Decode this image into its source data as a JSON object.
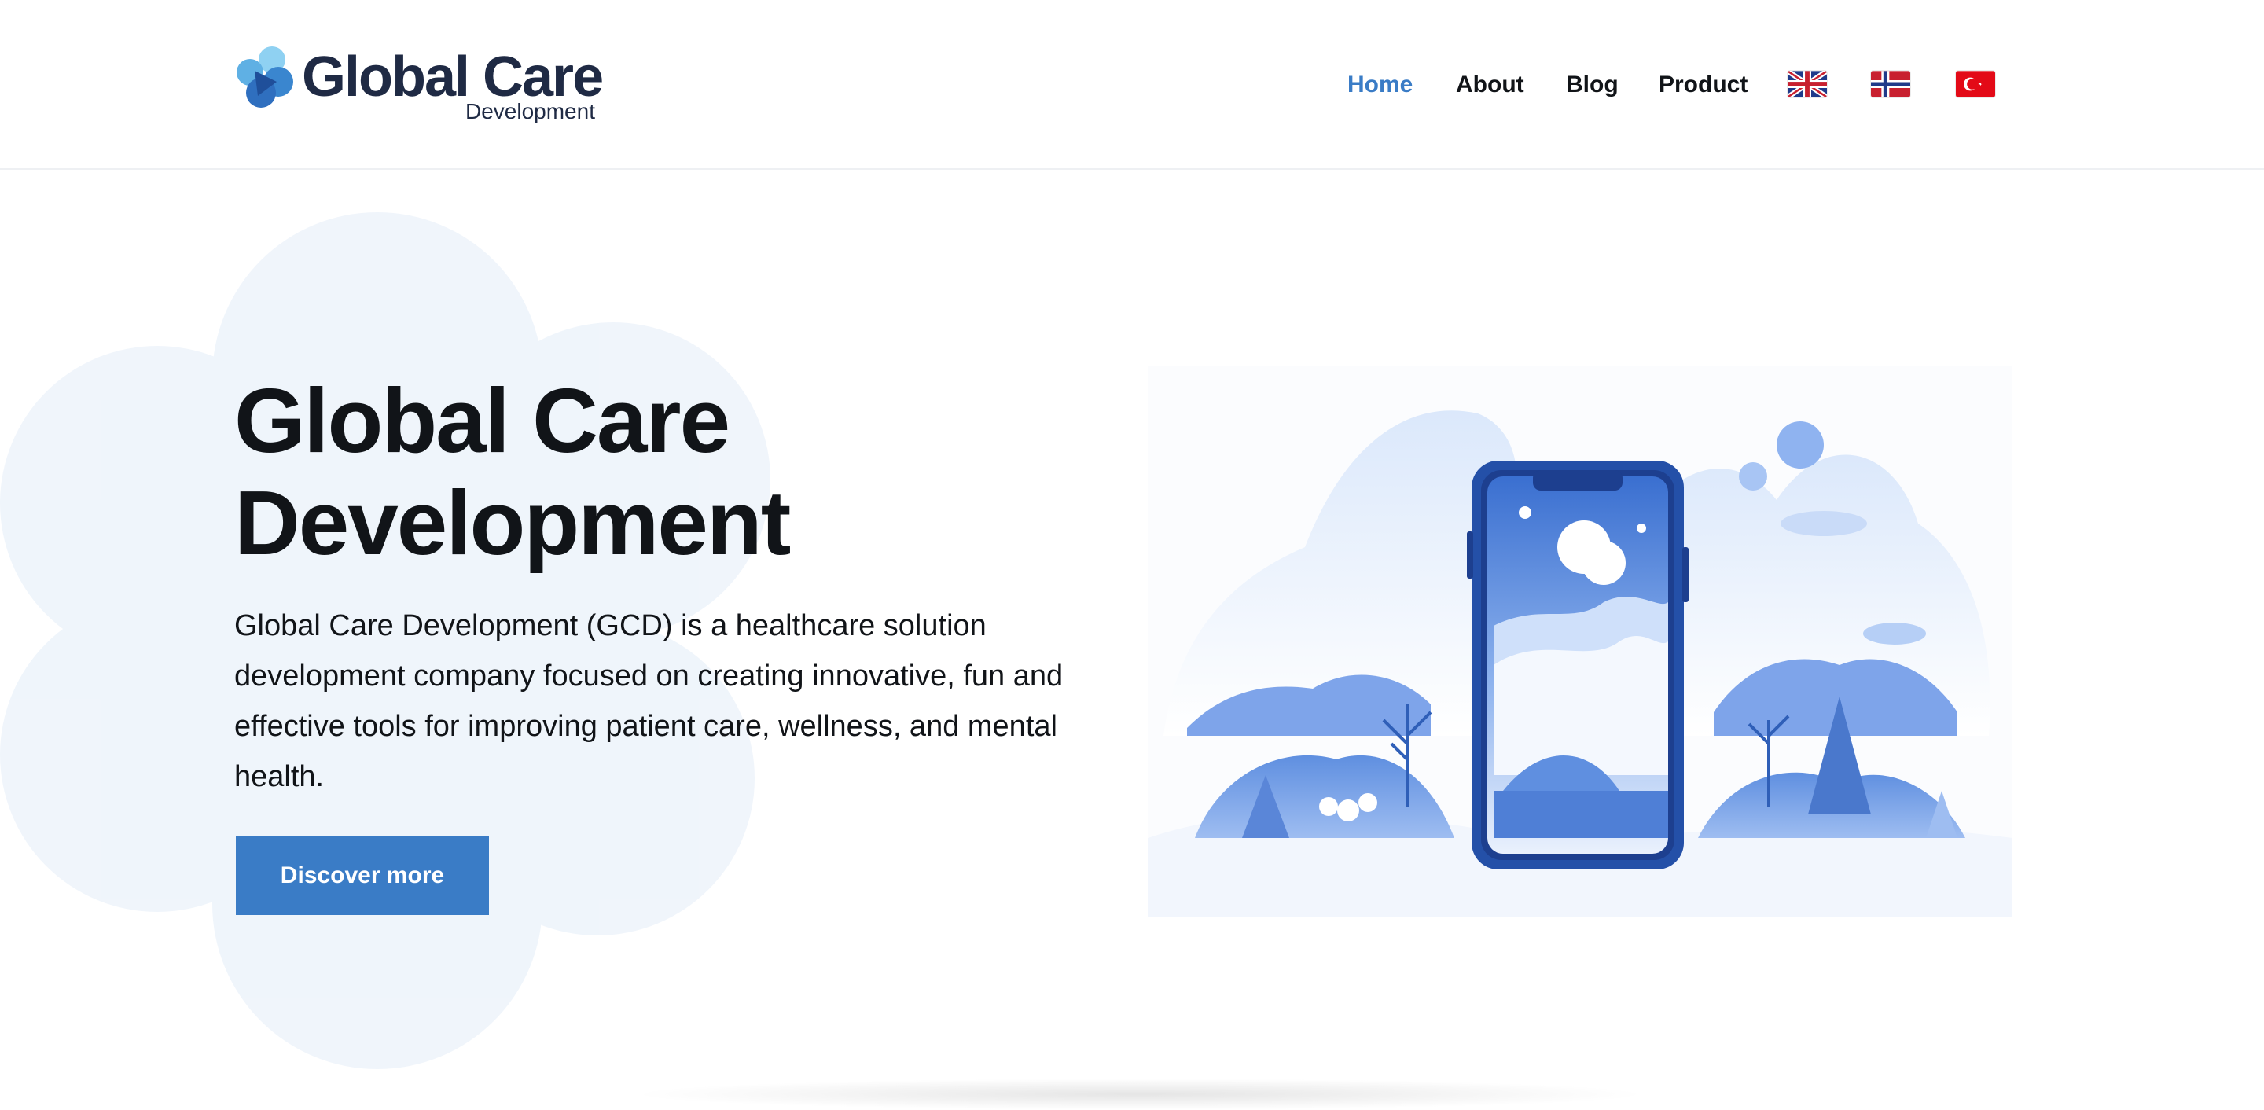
{
  "brand": {
    "name": "Global Care",
    "subtitle": "Development",
    "logo_icon": "flower-logo-icon",
    "colors": {
      "dark": "#1f2a44",
      "accent": "#3a7cc6",
      "light": "#6fc0ee"
    }
  },
  "nav": {
    "items": [
      {
        "label": "Home",
        "active": true
      },
      {
        "label": "About",
        "active": false
      },
      {
        "label": "Blog",
        "active": false
      },
      {
        "label": "Product",
        "active": false
      }
    ],
    "languages": [
      {
        "icon": "uk-flag-icon"
      },
      {
        "icon": "norway-flag-icon"
      },
      {
        "icon": "turkey-flag-icon"
      }
    ]
  },
  "hero": {
    "title": "Global Care Development",
    "description": "Global Care Development (GCD) is a healthcare solution development company focused on creating innovative, fun and effective tools for improving patient care, wellness, and mental health.",
    "cta_label": "Discover more",
    "illustration": "phone-winter-landscape-illustration"
  }
}
